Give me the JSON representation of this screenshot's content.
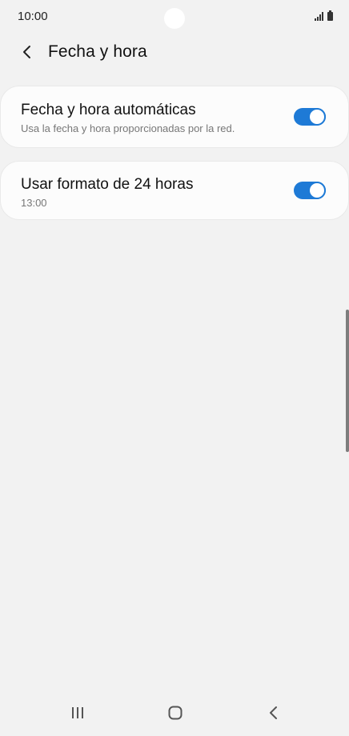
{
  "status_bar": {
    "time": "10:00"
  },
  "header": {
    "title": "Fecha y hora",
    "back_icon": "chevron-left-icon"
  },
  "settings": [
    {
      "title": "Fecha y hora automáticas",
      "subtitle": "Usa la fecha y hora proporcionadas por la red.",
      "enabled": true
    },
    {
      "title": "Usar formato de 24 horas",
      "subtitle": "13:00",
      "enabled": true
    }
  ],
  "colors": {
    "accent": "#1e7ad6",
    "background": "#f2f2f2",
    "card": "#fcfcfc"
  },
  "nav_bar": {
    "recents_icon": "recents-icon",
    "home_icon": "home-icon",
    "back_icon": "back-icon"
  }
}
